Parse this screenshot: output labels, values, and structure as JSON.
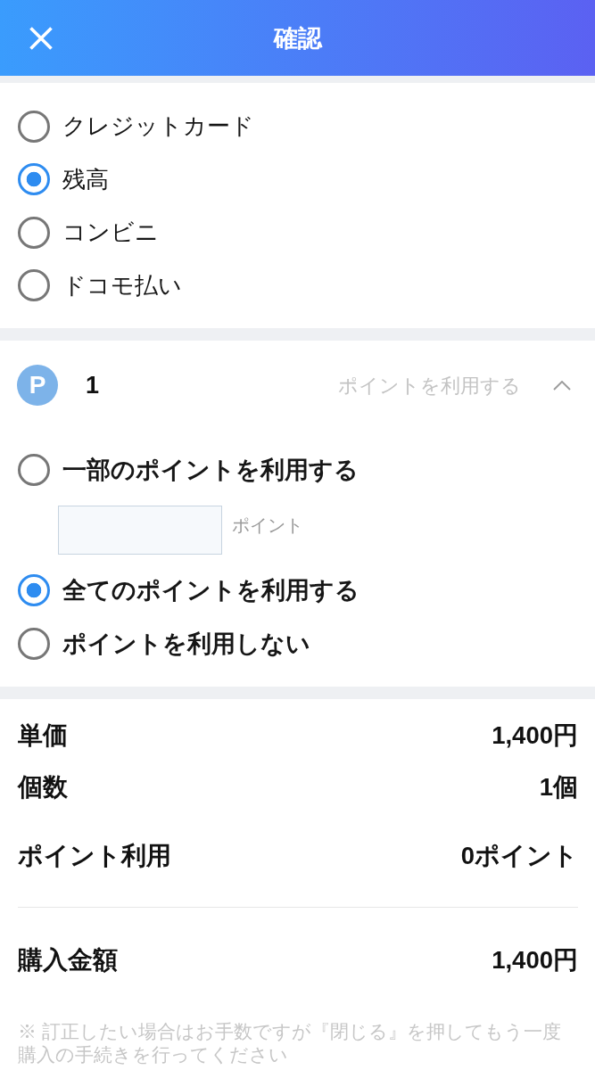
{
  "header": {
    "title": "確認"
  },
  "payment_methods": [
    {
      "label": "クレジットカード",
      "selected": false
    },
    {
      "label": "残高",
      "selected": true
    },
    {
      "label": "コンビニ",
      "selected": false
    },
    {
      "label": "ドコモ払い",
      "selected": false
    }
  ],
  "points": {
    "badge": "P",
    "balance": "1",
    "toggle": {
      "label": "ポイントを利用する",
      "expanded": true
    },
    "options": [
      {
        "kind": "amount",
        "label": "一部のポイントを利用する",
        "selected": false,
        "unit": "ポイント"
      },
      {
        "kind": "plain",
        "label": "全てのポイントを利用する",
        "selected": true
      },
      {
        "kind": "plain",
        "label": "ポイントを利用しない",
        "selected": false
      }
    ]
  },
  "summary": {
    "rows": [
      {
        "label": "単価",
        "value": "1,400円"
      },
      {
        "label": "個数",
        "value": "1個"
      },
      {
        "label": "ポイント利用",
        "value": "0ポイント"
      }
    ],
    "total": {
      "label": "購入金額",
      "value": "1,400円"
    }
  },
  "note": "※ 訂正したい場合はお手数ですが『閉じる』を押してもう一度購入の手続きを行ってください"
}
